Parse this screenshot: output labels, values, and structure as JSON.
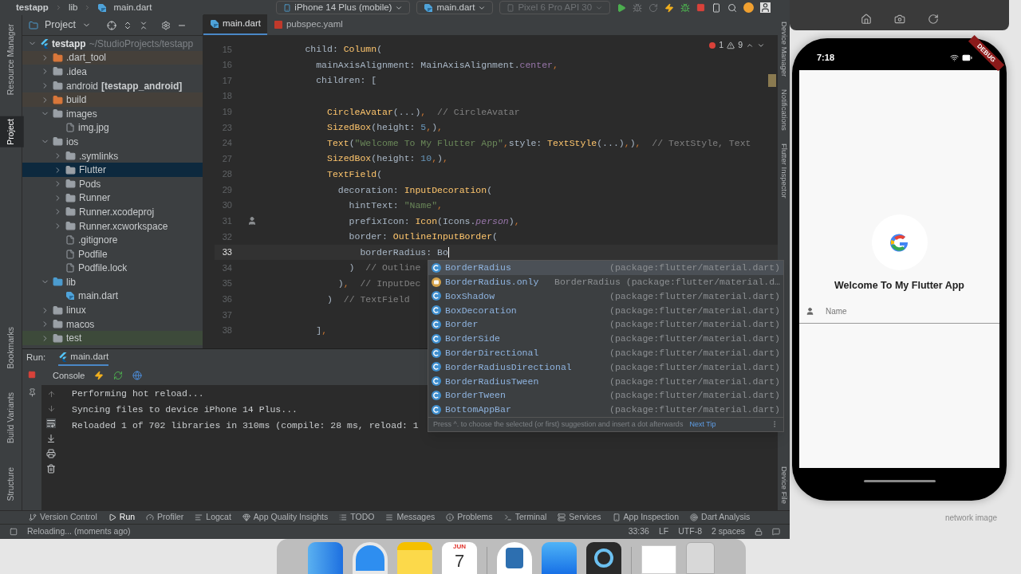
{
  "title_bar": {
    "breadcrumbs": [
      "testapp",
      "lib",
      "main.dart"
    ],
    "device": "iPhone 14 Plus (mobile)",
    "run_config": "main.dart",
    "emulator": {
      "label": "Pixel 6 Pro API 30",
      "disabled": true
    }
  },
  "left_stripe": {
    "top": [
      {
        "label": "Resource Manager",
        "selected": false
      },
      {
        "label": "Project",
        "selected": true
      }
    ],
    "bottom": [
      {
        "label": "Bookmarks",
        "selected": false
      },
      {
        "label": "Build Variants",
        "selected": false
      },
      {
        "label": "Structure",
        "selected": false
      }
    ]
  },
  "right_stripe": {
    "top": [
      {
        "label": "Device Manager",
        "selected": false
      },
      {
        "label": "Notifications",
        "selected": false
      },
      {
        "label": "Flutter Inspector",
        "selected": false
      }
    ],
    "bottom": [
      {
        "label": "Device File",
        "selected": false
      }
    ]
  },
  "project": {
    "title": "Project",
    "tree": [
      {
        "name": "testapp",
        "suffix": "~/StudioProjects/testapp",
        "kind": "module",
        "expanded": true,
        "selected": false,
        "children": [
          {
            "name": ".dart_tool",
            "kind": "folder",
            "color": "#45403a",
            "expanded": false,
            "selected": false
          },
          {
            "name": ".idea",
            "kind": "folder",
            "expanded": false,
            "selected": false
          },
          {
            "name": "android",
            "suffix": "[testapp_android]",
            "kind": "folder",
            "expanded": false,
            "selected": false
          },
          {
            "name": "build",
            "kind": "folder",
            "color": "#45403a",
            "expanded": false,
            "selected": false
          },
          {
            "name": "images",
            "kind": "folder",
            "expanded": true,
            "selected": false,
            "children": [
              {
                "name": "img.jpg",
                "kind": "file",
                "selected": false
              }
            ]
          },
          {
            "name": "ios",
            "kind": "folder",
            "expanded": true,
            "selected": false,
            "children": [
              {
                "name": ".symlinks",
                "kind": "folder",
                "expanded": false,
                "selected": false
              },
              {
                "name": "Flutter",
                "kind": "folder",
                "expanded": false,
                "selected": true
              },
              {
                "name": "Pods",
                "kind": "folder",
                "expanded": false,
                "selected": false
              },
              {
                "name": "Runner",
                "kind": "folder",
                "expanded": false,
                "selected": false
              },
              {
                "name": "Runner.xcodeproj",
                "kind": "folder",
                "expanded": false,
                "selected": false
              },
              {
                "name": "Runner.xcworkspace",
                "kind": "folder",
                "expanded": false,
                "selected": false
              },
              {
                "name": ".gitignore",
                "kind": "file",
                "selected": false
              },
              {
                "name": "Podfile",
                "kind": "file",
                "selected": false
              },
              {
                "name": "Podfile.lock",
                "kind": "file",
                "selected": false
              }
            ]
          },
          {
            "name": "lib",
            "kind": "source-folder",
            "expanded": true,
            "selected": false,
            "children": [
              {
                "name": "main.dart",
                "kind": "dart",
                "selected": false
              }
            ]
          },
          {
            "name": "linux",
            "kind": "folder",
            "expanded": false,
            "selected": false
          },
          {
            "name": "macos",
            "kind": "folder",
            "expanded": false,
            "selected": false
          },
          {
            "name": "test",
            "kind": "folder",
            "color": "#3d4a3a",
            "expanded": false,
            "selected": false
          }
        ]
      }
    ]
  },
  "editor": {
    "tabs": [
      {
        "label": "main.dart",
        "kind": "dart",
        "selected": true
      },
      {
        "label": "pubspec.yaml",
        "kind": "yaml",
        "selected": false
      }
    ],
    "errors": "1",
    "warnings": "9",
    "lines": [
      {
        "number": "15",
        "current": false,
        "segments": [
          {
            "kind": "p",
            "text": "      child: "
          },
          {
            "kind": "call",
            "text": "Column"
          },
          {
            "kind": "p",
            "text": "("
          }
        ]
      },
      {
        "number": "16",
        "current": false,
        "segments": [
          {
            "kind": "p",
            "text": "        mainAxisAlignment: MainAxisAlignment."
          },
          {
            "kind": "const",
            "text": "center"
          },
          {
            "kind": "punct",
            "text": ","
          }
        ]
      },
      {
        "number": "17",
        "current": false,
        "segments": [
          {
            "kind": "p",
            "text": "        children: ["
          }
        ]
      },
      {
        "number": "18",
        "current": false
      },
      {
        "number": "19",
        "current": false,
        "segments": [
          {
            "kind": "call",
            "text": "          CircleAvatar"
          },
          {
            "kind": "p",
            "text": "(...)"
          },
          {
            "kind": "punct",
            "text": ","
          },
          {
            "kind": "cmt",
            "text": "  // CircleAvatar"
          }
        ]
      },
      {
        "number": "23",
        "current": false,
        "segments": [
          {
            "kind": "call",
            "text": "          SizedBox"
          },
          {
            "kind": "p",
            "text": "(height: "
          },
          {
            "kind": "num",
            "text": "5"
          },
          {
            "kind": "punct",
            "text": ","
          },
          {
            "kind": "p",
            "text": ")"
          },
          {
            "kind": "punct",
            "text": ","
          }
        ]
      },
      {
        "number": "24",
        "current": false,
        "segments": [
          {
            "kind": "call",
            "text": "          Text"
          },
          {
            "kind": "p",
            "text": "("
          },
          {
            "kind": "str",
            "text": "\"Welcome To My Flutter App\""
          },
          {
            "kind": "punct",
            "text": ","
          },
          {
            "kind": "p",
            "text": "style: "
          },
          {
            "kind": "call",
            "text": "TextStyle"
          },
          {
            "kind": "p",
            "text": "(...)"
          },
          {
            "kind": "punct",
            "text": ","
          },
          {
            "kind": "p",
            "text": ")"
          },
          {
            "kind": "punct",
            "text": ","
          },
          {
            "kind": "cmt",
            "text": "  // TextStyle, Text"
          }
        ]
      },
      {
        "number": "27",
        "current": false,
        "segments": [
          {
            "kind": "call",
            "text": "          SizedBox"
          },
          {
            "kind": "p",
            "text": "(height: "
          },
          {
            "kind": "num",
            "text": "10"
          },
          {
            "kind": "punct",
            "text": ","
          },
          {
            "kind": "p",
            "text": ")"
          },
          {
            "kind": "punct",
            "text": ","
          }
        ]
      },
      {
        "number": "28",
        "current": false,
        "segments": [
          {
            "kind": "call",
            "text": "          TextField"
          },
          {
            "kind": "p",
            "text": "("
          }
        ]
      },
      {
        "number": "29",
        "current": false,
        "segments": [
          {
            "kind": "p",
            "text": "            decoration: "
          },
          {
            "kind": "call",
            "text": "InputDecoration"
          },
          {
            "kind": "p",
            "text": "("
          }
        ]
      },
      {
        "number": "30",
        "current": false,
        "segments": [
          {
            "kind": "p",
            "text": "              hintText: "
          },
          {
            "kind": "str",
            "text": "\"Name\""
          },
          {
            "kind": "punct",
            "text": ","
          }
        ]
      },
      {
        "number": "31",
        "current": false,
        "gutter_icon": true,
        "segments": [
          {
            "kind": "p",
            "text": "              prefixIcon: "
          },
          {
            "kind": "call",
            "text": "Icon"
          },
          {
            "kind": "p",
            "text": "(Icons."
          },
          {
            "kind": "italic",
            "text": "person"
          },
          {
            "kind": "p",
            "text": ")"
          },
          {
            "kind": "punct",
            "text": ","
          }
        ]
      },
      {
        "number": "32",
        "current": false,
        "segments": [
          {
            "kind": "p",
            "text": "              border: "
          },
          {
            "kind": "call",
            "text": "OutlineInputBorder"
          },
          {
            "kind": "p",
            "text": "("
          }
        ]
      },
      {
        "number": "33",
        "current": true,
        "segments": [
          {
            "kind": "p",
            "text": "                borderRadius: Bo"
          }
        ]
      },
      {
        "number": "34",
        "current": false,
        "segments": [
          {
            "kind": "p",
            "text": "              )"
          },
          {
            "kind": "cmt",
            "text": "  // Outline"
          }
        ]
      },
      {
        "number": "35",
        "current": false,
        "segments": [
          {
            "kind": "p",
            "text": "            )"
          },
          {
            "kind": "punct",
            "text": ","
          },
          {
            "kind": "cmt",
            "text": "  // InputDec"
          }
        ]
      },
      {
        "number": "36",
        "current": false,
        "segments": [
          {
            "kind": "p",
            "text": "          )"
          },
          {
            "kind": "cmt",
            "text": "  // TextField"
          }
        ]
      },
      {
        "number": "37",
        "current": false
      },
      {
        "number": "38",
        "current": false,
        "segments": [
          {
            "kind": "p",
            "text": "        ]"
          },
          {
            "kind": "punct",
            "text": ","
          }
        ]
      }
    ]
  },
  "completion": {
    "items": [
      {
        "name": "BorderRadius",
        "hint": "(package:flutter/material.dart)",
        "kind": "class",
        "selected": true
      },
      {
        "name": "BorderRadius.only",
        "hint": "BorderRadius (package:flutter/material.d…",
        "kind": "method",
        "selected": false
      },
      {
        "name": "BoxShadow",
        "hint": "(package:flutter/material.dart)",
        "kind": "class",
        "selected": false
      },
      {
        "name": "BoxDecoration",
        "hint": "(package:flutter/material.dart)",
        "kind": "class",
        "selected": false
      },
      {
        "name": "Border",
        "hint": "(package:flutter/material.dart)",
        "kind": "class",
        "selected": false
      },
      {
        "name": "BorderSide",
        "hint": "(package:flutter/material.dart)",
        "kind": "class",
        "selected": false
      },
      {
        "name": "BorderDirectional",
        "hint": "(package:flutter/material.dart)",
        "kind": "class",
        "selected": false
      },
      {
        "name": "BorderRadiusDirectional",
        "hint": "(package:flutter/material.dart)",
        "kind": "class",
        "selected": false
      },
      {
        "name": "BorderRadiusTween",
        "hint": "(package:flutter/material.dart)",
        "kind": "class",
        "selected": false
      },
      {
        "name": "BorderTween",
        "hint": "(package:flutter/material.dart)",
        "kind": "class",
        "selected": false
      },
      {
        "name": "BottomAppBar",
        "hint": "(package:flutter/material.dart)",
        "kind": "class",
        "selected": false
      }
    ],
    "footer": "Press ^. to choose the selected (or first) suggestion and insert a dot afterwards",
    "tip_link": "Next Tip"
  },
  "run": {
    "title": "Run:",
    "tab": "main.dart",
    "console_tab": "Console",
    "output": [
      "Performing hot reload...",
      "Syncing files to device iPhone 14 Plus...",
      "Reloaded 1 of 702 libraries in 310ms (compile: 28 ms, reload: 1"
    ]
  },
  "tool_buttons": [
    {
      "label": "Version Control",
      "selected": false
    },
    {
      "label": "Run",
      "selected": true
    },
    {
      "label": "Profiler",
      "selected": false
    },
    {
      "label": "Logcat",
      "selected": false
    },
    {
      "label": "App Quality Insights",
      "selected": false
    },
    {
      "label": "TODO",
      "selected": false
    },
    {
      "label": "Messages",
      "selected": false
    },
    {
      "label": "Problems",
      "selected": false
    },
    {
      "label": "Terminal",
      "selected": false
    },
    {
      "label": "Services",
      "selected": false
    },
    {
      "label": "App Inspection",
      "selected": false
    },
    {
      "label": "Dart Analysis",
      "selected": false
    }
  ],
  "status_bar": {
    "message": "Reloading... (moments ago)",
    "position": "33:36",
    "line_separator": "LF",
    "encoding": "UTF-8",
    "indent": "2 spaces"
  },
  "simulator": {
    "time": "7:18",
    "debug_banner": "DEBUG",
    "welcome": "Welcome To My Flutter App",
    "field": {
      "placeholder": "Name"
    }
  },
  "desktop": {
    "caption": "network image"
  },
  "dock": {
    "calendar_month": "JUN",
    "calendar_day": "7"
  }
}
